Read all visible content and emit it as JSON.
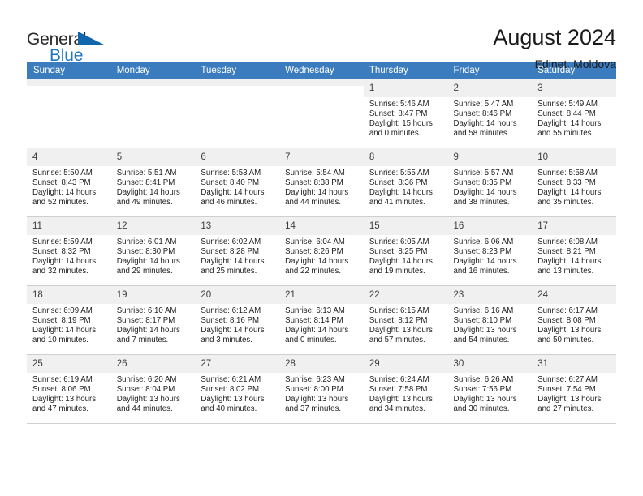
{
  "brand": {
    "name_top": "General",
    "name_bottom": "Blue",
    "flag_color": "#1266ad",
    "blue_color": "#1f77c2"
  },
  "header": {
    "title": "August 2024",
    "subtitle": "Edinet, Moldova"
  },
  "theme": {
    "header_bg": "#3a7cbe",
    "cell_shade": "#f0f0f0",
    "grid_line": "#cfcfcf"
  },
  "weekdays": [
    "Sunday",
    "Monday",
    "Tuesday",
    "Wednesday",
    "Thursday",
    "Friday",
    "Saturday"
  ],
  "labels": {
    "sunrise": "Sunrise:",
    "sunset": "Sunset:",
    "daylight": "Daylight:"
  },
  "weeks": [
    [
      {
        "day": "",
        "sunrise": "",
        "sunset": "",
        "daylight1": "",
        "daylight2": ""
      },
      {
        "day": "",
        "sunrise": "",
        "sunset": "",
        "daylight1": "",
        "daylight2": ""
      },
      {
        "day": "",
        "sunrise": "",
        "sunset": "",
        "daylight1": "",
        "daylight2": ""
      },
      {
        "day": "",
        "sunrise": "",
        "sunset": "",
        "daylight1": "",
        "daylight2": ""
      },
      {
        "day": "1",
        "sunrise": "Sunrise: 5:46 AM",
        "sunset": "Sunset: 8:47 PM",
        "daylight1": "Daylight: 15 hours",
        "daylight2": "and 0 minutes."
      },
      {
        "day": "2",
        "sunrise": "Sunrise: 5:47 AM",
        "sunset": "Sunset: 8:46 PM",
        "daylight1": "Daylight: 14 hours",
        "daylight2": "and 58 minutes."
      },
      {
        "day": "3",
        "sunrise": "Sunrise: 5:49 AM",
        "sunset": "Sunset: 8:44 PM",
        "daylight1": "Daylight: 14 hours",
        "daylight2": "and 55 minutes."
      }
    ],
    [
      {
        "day": "4",
        "sunrise": "Sunrise: 5:50 AM",
        "sunset": "Sunset: 8:43 PM",
        "daylight1": "Daylight: 14 hours",
        "daylight2": "and 52 minutes."
      },
      {
        "day": "5",
        "sunrise": "Sunrise: 5:51 AM",
        "sunset": "Sunset: 8:41 PM",
        "daylight1": "Daylight: 14 hours",
        "daylight2": "and 49 minutes."
      },
      {
        "day": "6",
        "sunrise": "Sunrise: 5:53 AM",
        "sunset": "Sunset: 8:40 PM",
        "daylight1": "Daylight: 14 hours",
        "daylight2": "and 46 minutes."
      },
      {
        "day": "7",
        "sunrise": "Sunrise: 5:54 AM",
        "sunset": "Sunset: 8:38 PM",
        "daylight1": "Daylight: 14 hours",
        "daylight2": "and 44 minutes."
      },
      {
        "day": "8",
        "sunrise": "Sunrise: 5:55 AM",
        "sunset": "Sunset: 8:36 PM",
        "daylight1": "Daylight: 14 hours",
        "daylight2": "and 41 minutes."
      },
      {
        "day": "9",
        "sunrise": "Sunrise: 5:57 AM",
        "sunset": "Sunset: 8:35 PM",
        "daylight1": "Daylight: 14 hours",
        "daylight2": "and 38 minutes."
      },
      {
        "day": "10",
        "sunrise": "Sunrise: 5:58 AM",
        "sunset": "Sunset: 8:33 PM",
        "daylight1": "Daylight: 14 hours",
        "daylight2": "and 35 minutes."
      }
    ],
    [
      {
        "day": "11",
        "sunrise": "Sunrise: 5:59 AM",
        "sunset": "Sunset: 8:32 PM",
        "daylight1": "Daylight: 14 hours",
        "daylight2": "and 32 minutes."
      },
      {
        "day": "12",
        "sunrise": "Sunrise: 6:01 AM",
        "sunset": "Sunset: 8:30 PM",
        "daylight1": "Daylight: 14 hours",
        "daylight2": "and 29 minutes."
      },
      {
        "day": "13",
        "sunrise": "Sunrise: 6:02 AM",
        "sunset": "Sunset: 8:28 PM",
        "daylight1": "Daylight: 14 hours",
        "daylight2": "and 25 minutes."
      },
      {
        "day": "14",
        "sunrise": "Sunrise: 6:04 AM",
        "sunset": "Sunset: 8:26 PM",
        "daylight1": "Daylight: 14 hours",
        "daylight2": "and 22 minutes."
      },
      {
        "day": "15",
        "sunrise": "Sunrise: 6:05 AM",
        "sunset": "Sunset: 8:25 PM",
        "daylight1": "Daylight: 14 hours",
        "daylight2": "and 19 minutes."
      },
      {
        "day": "16",
        "sunrise": "Sunrise: 6:06 AM",
        "sunset": "Sunset: 8:23 PM",
        "daylight1": "Daylight: 14 hours",
        "daylight2": "and 16 minutes."
      },
      {
        "day": "17",
        "sunrise": "Sunrise: 6:08 AM",
        "sunset": "Sunset: 8:21 PM",
        "daylight1": "Daylight: 14 hours",
        "daylight2": "and 13 minutes."
      }
    ],
    [
      {
        "day": "18",
        "sunrise": "Sunrise: 6:09 AM",
        "sunset": "Sunset: 8:19 PM",
        "daylight1": "Daylight: 14 hours",
        "daylight2": "and 10 minutes."
      },
      {
        "day": "19",
        "sunrise": "Sunrise: 6:10 AM",
        "sunset": "Sunset: 8:17 PM",
        "daylight1": "Daylight: 14 hours",
        "daylight2": "and 7 minutes."
      },
      {
        "day": "20",
        "sunrise": "Sunrise: 6:12 AM",
        "sunset": "Sunset: 8:16 PM",
        "daylight1": "Daylight: 14 hours",
        "daylight2": "and 3 minutes."
      },
      {
        "day": "21",
        "sunrise": "Sunrise: 6:13 AM",
        "sunset": "Sunset: 8:14 PM",
        "daylight1": "Daylight: 14 hours",
        "daylight2": "and 0 minutes."
      },
      {
        "day": "22",
        "sunrise": "Sunrise: 6:15 AM",
        "sunset": "Sunset: 8:12 PM",
        "daylight1": "Daylight: 13 hours",
        "daylight2": "and 57 minutes."
      },
      {
        "day": "23",
        "sunrise": "Sunrise: 6:16 AM",
        "sunset": "Sunset: 8:10 PM",
        "daylight1": "Daylight: 13 hours",
        "daylight2": "and 54 minutes."
      },
      {
        "day": "24",
        "sunrise": "Sunrise: 6:17 AM",
        "sunset": "Sunset: 8:08 PM",
        "daylight1": "Daylight: 13 hours",
        "daylight2": "and 50 minutes."
      }
    ],
    [
      {
        "day": "25",
        "sunrise": "Sunrise: 6:19 AM",
        "sunset": "Sunset: 8:06 PM",
        "daylight1": "Daylight: 13 hours",
        "daylight2": "and 47 minutes."
      },
      {
        "day": "26",
        "sunrise": "Sunrise: 6:20 AM",
        "sunset": "Sunset: 8:04 PM",
        "daylight1": "Daylight: 13 hours",
        "daylight2": "and 44 minutes."
      },
      {
        "day": "27",
        "sunrise": "Sunrise: 6:21 AM",
        "sunset": "Sunset: 8:02 PM",
        "daylight1": "Daylight: 13 hours",
        "daylight2": "and 40 minutes."
      },
      {
        "day": "28",
        "sunrise": "Sunrise: 6:23 AM",
        "sunset": "Sunset: 8:00 PM",
        "daylight1": "Daylight: 13 hours",
        "daylight2": "and 37 minutes."
      },
      {
        "day": "29",
        "sunrise": "Sunrise: 6:24 AM",
        "sunset": "Sunset: 7:58 PM",
        "daylight1": "Daylight: 13 hours",
        "daylight2": "and 34 minutes."
      },
      {
        "day": "30",
        "sunrise": "Sunrise: 6:26 AM",
        "sunset": "Sunset: 7:56 PM",
        "daylight1": "Daylight: 13 hours",
        "daylight2": "and 30 minutes."
      },
      {
        "day": "31",
        "sunrise": "Sunrise: 6:27 AM",
        "sunset": "Sunset: 7:54 PM",
        "daylight1": "Daylight: 13 hours",
        "daylight2": "and 27 minutes."
      }
    ]
  ]
}
